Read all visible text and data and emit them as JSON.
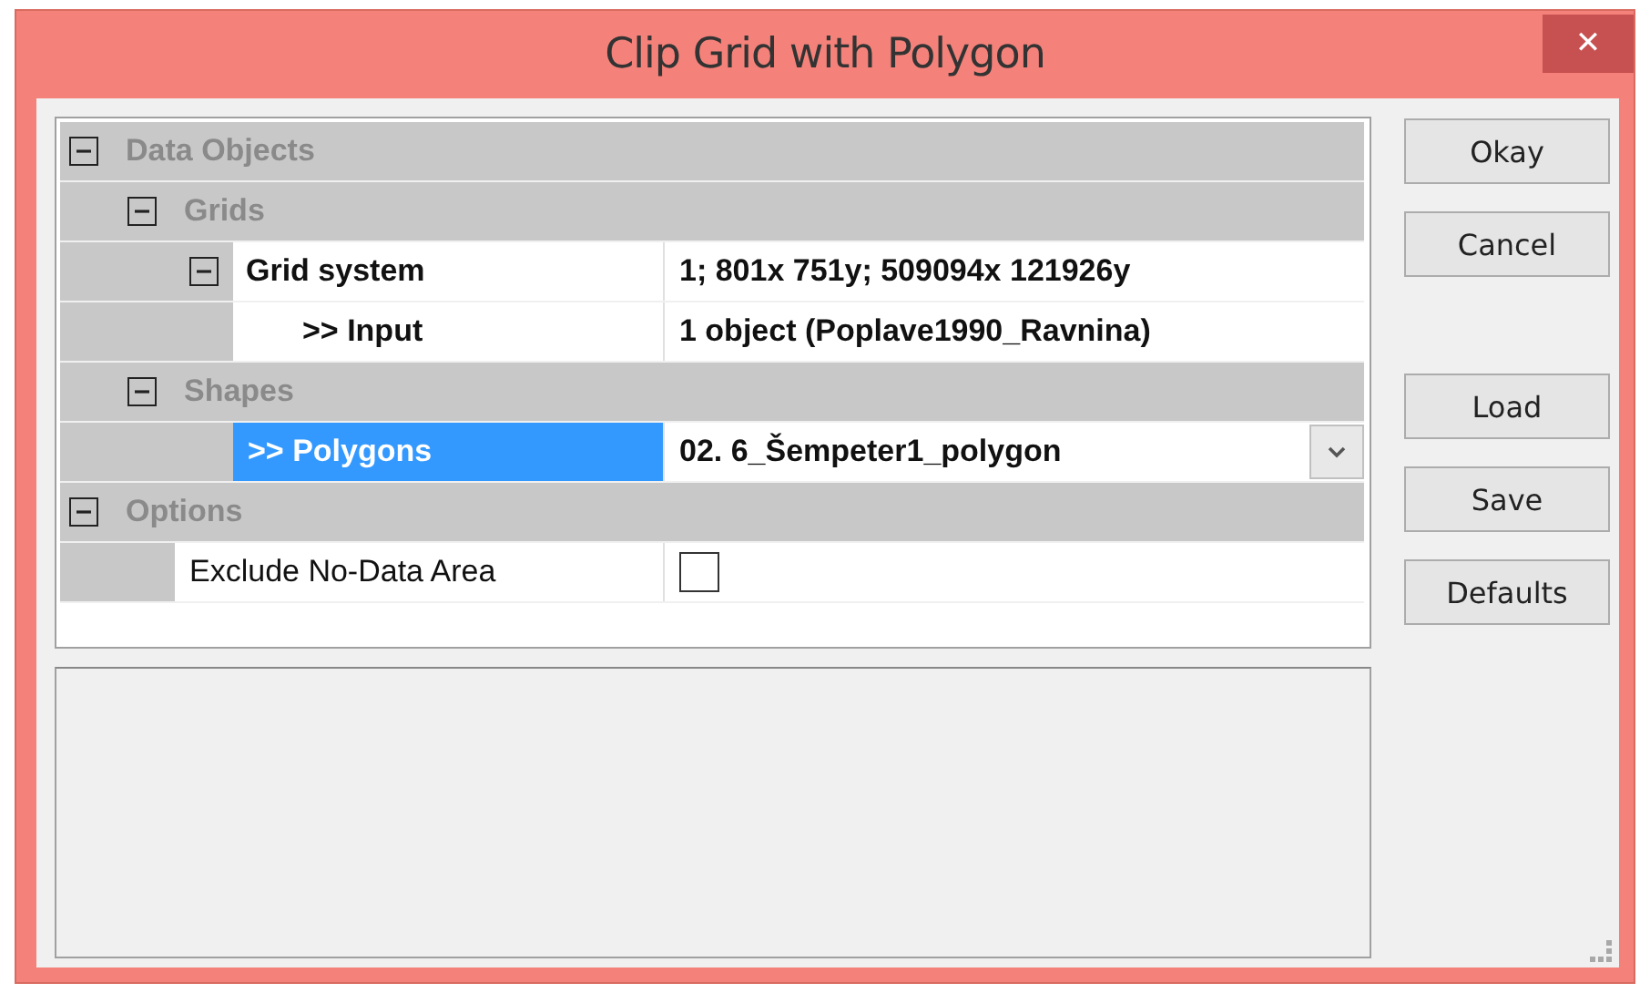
{
  "window": {
    "title": "Clip Grid with Polygon",
    "close": "✕"
  },
  "tree": [
    {
      "kind": "category",
      "label": "Data Objects",
      "expanded": true,
      "children": [
        {
          "kind": "category",
          "label": "Grids",
          "expanded": true,
          "children": [
            {
              "kind": "group",
              "label": "Grid system",
              "value": "1; 801x 751y; 509094x 121926y",
              "expanded": true,
              "children": [
                {
                  "kind": "property",
                  "label": ">> Input",
                  "value": "1 object (Poplave1990_Ravnina)",
                  "selected": false
                }
              ]
            }
          ]
        },
        {
          "kind": "category",
          "label": "Shapes",
          "expanded": true,
          "children": [
            {
              "kind": "choice",
              "label": ">> Polygons",
              "value": "02. 6_Šempeter1_polygon",
              "selected": true
            }
          ]
        }
      ]
    },
    {
      "kind": "category",
      "label": "Options",
      "expanded": true,
      "children": [
        {
          "kind": "checkbox",
          "label": "Exclude No-Data Area",
          "checked": false,
          "selected": false
        }
      ]
    }
  ],
  "dialog_buttons": [
    "Okay",
    "Cancel"
  ],
  "settings_buttons": [
    "Load",
    "Save",
    "Defaults"
  ]
}
